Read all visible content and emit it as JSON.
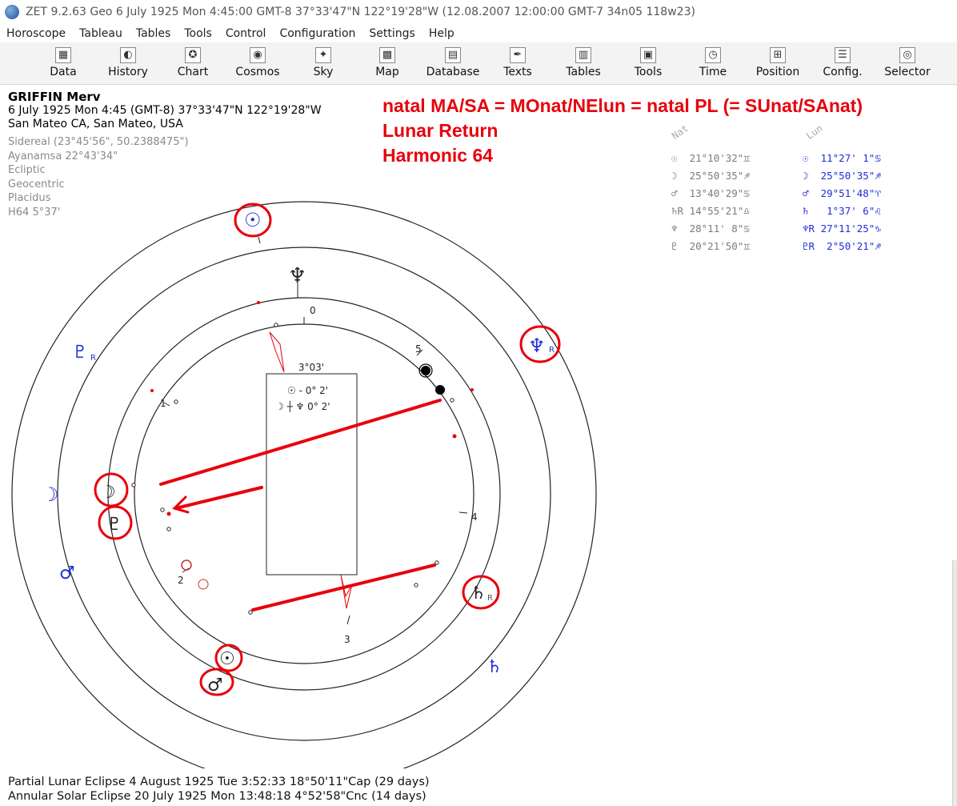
{
  "window": {
    "title": "ZET 9.2.63 Geo    6 July 1925  Mon   4:45:00 GMT-8 37°33'47\"N  122°19'28\"W  (12.08.2007  12:00:00 GMT-7 34n05 118w23)"
  },
  "menu": [
    "Horoscope",
    "Tableau",
    "Tables",
    "Tools",
    "Control",
    "Configuration",
    "Settings",
    "Help"
  ],
  "toolbar": [
    {
      "label": "Data",
      "icon": "data-icon",
      "glyph": "▦"
    },
    {
      "label": "History",
      "icon": "history-icon",
      "glyph": "◐"
    },
    {
      "label": "Chart",
      "icon": "chart-icon",
      "glyph": "✪"
    },
    {
      "label": "Cosmos",
      "icon": "cosmos-icon",
      "glyph": "◉"
    },
    {
      "label": "Sky",
      "icon": "sky-icon",
      "glyph": "✦"
    },
    {
      "label": "Map",
      "icon": "map-icon",
      "glyph": "▩"
    },
    {
      "label": "Database",
      "icon": "database-icon",
      "glyph": "▤"
    },
    {
      "label": "Texts",
      "icon": "texts-icon",
      "glyph": "✒"
    },
    {
      "label": "Tables",
      "icon": "tables-icon",
      "glyph": "▥"
    },
    {
      "label": "Tools",
      "icon": "tools-icon",
      "glyph": "▣"
    },
    {
      "label": "Time",
      "icon": "time-icon",
      "glyph": "◷"
    },
    {
      "label": "Position",
      "icon": "position-icon",
      "glyph": "⊞"
    },
    {
      "label": "Config.",
      "icon": "config-icon",
      "glyph": "☰"
    },
    {
      "label": "Selector",
      "icon": "selector-icon",
      "glyph": "◎"
    }
  ],
  "chart_info": {
    "name": "GRIFFIN Merv",
    "datetime": "6 July 1925  Mon   4:45 (GMT-8) 37°33'47\"N  122°19'28\"W",
    "place": "San Mateo CA, San Mateo, USA",
    "settings": [
      "Sidereal (23°45'56\", 50.2388475\")",
      "Ayanamsa 22°43'34\"",
      "Ecliptic",
      "Geocentric",
      "Placidus",
      "H64   5°37'"
    ]
  },
  "annotation": {
    "lines": [
      "natal MA/SA = MOnat/NElun = natal PL (= SUnat/SAnat)",
      "Lunar Return",
      "Harmonic 64"
    ]
  },
  "positions": {
    "nat_header": "Nat",
    "lun_header": "Lun",
    "nat": [
      {
        "glyph": "☉",
        "text": "21°10'32\"♊"
      },
      {
        "glyph": "☽",
        "text": "25°50'35\"♐"
      },
      {
        "glyph": "♂",
        "text": "13°40'29\"♋"
      },
      {
        "glyph": "♄R",
        "text": "14°55'21\"♎"
      },
      {
        "glyph": "♆",
        "text": "28°11' 8\"♋"
      },
      {
        "glyph": "♇",
        "text": "20°21'50\"♊"
      }
    ],
    "lun": [
      {
        "glyph": "☉",
        "text": "11°27' 1\"♋"
      },
      {
        "glyph": "☽",
        "text": "25°50'35\"♐"
      },
      {
        "glyph": "♂",
        "text": "29°51'48\"♈"
      },
      {
        "glyph": "♄",
        "text": " 1°37' 6\"♌"
      },
      {
        "glyph": "♆R",
        "text": "27°11'25\"♑"
      },
      {
        "glyph": "♇R",
        "text": " 2°50'21\"♐"
      }
    ]
  },
  "aspect_box": {
    "header": "3°03'",
    "row1": "☉   - 0° 2'",
    "row2": "☽ ┼ ♆   0° 2'"
  },
  "house_numbers": [
    "0",
    "1",
    "2",
    "3",
    "4",
    "5"
  ],
  "wheel_glyphs": {
    "sun_outer": "☉",
    "neptune_inner": "♆",
    "pluto_lunar": "♇",
    "pluto_lunar_r": "R",
    "neptune_lunar": "♆",
    "neptune_lunar_r": "R",
    "moon_lunar": "☽",
    "moon_natal": "☽",
    "pluto_natal": "♇",
    "mars_lunar": "♂",
    "saturn_natal": "♄",
    "saturn_natal_r": "R",
    "saturn_lunar": "♄",
    "sun_natal": "☉",
    "mars_natal": "♂"
  },
  "colors": {
    "annotation": "#e8000b",
    "lunar": "#1f2fd6",
    "natal": "#7c7c7c"
  },
  "footer": {
    "line1": "Partial Lunar Eclipse 4 August 1925 Tue  3:52:33 18°50'11\"Cap (29 days)",
    "line2": "Annular Solar Eclipse 20 July 1925 Mon 13:48:18  4°52'58\"Cnc (14 days)"
  }
}
